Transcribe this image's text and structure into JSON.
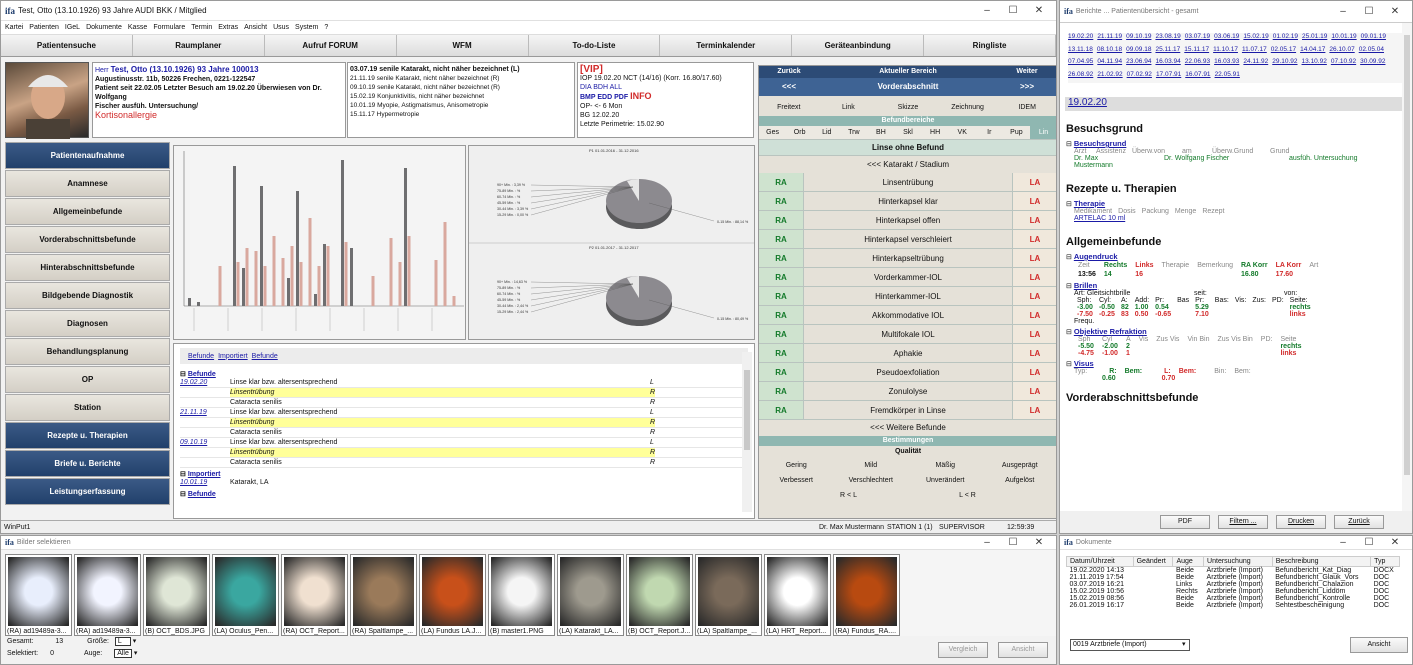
{
  "main_window": {
    "title": "Test, Otto   (13.10.1926)  93 Jahre      AUDI BKK / Mitglied",
    "logo": "ifa",
    "menu": [
      "Kartei",
      "Patienten",
      "IGeL",
      "Dokumente",
      "Kasse",
      "Formulare",
      "Termin",
      "Extras",
      "Ansicht",
      "Usus",
      "System",
      "?"
    ],
    "topnav": [
      "Patientensuche",
      "Raumplaner",
      "Aufruf FORUM",
      "WFM",
      "To-do-Liste",
      "Terminkalender",
      "Geräteanbindung",
      "Ringliste"
    ],
    "window_controls": {
      "minimize": "–",
      "maximize": "☐",
      "close": "✕"
    }
  },
  "patient": {
    "prefix": "Herr",
    "name_line": "Test, Otto     (13.10.1926)  93 Jahre    100013",
    "address": "Augustinusstr. 11b, 50226 Frechen, 0221-122547",
    "since": "Patient seit 22.02.05  Letzter Besuch am 19.02.20  Überwiesen von Dr. Wolfgang",
    "referrer": "Fischer          ausfüh. Untersuchung/",
    "allergy": "Kortisonallergie"
  },
  "diagnoses": [
    "03.07.19 senile Katarakt, nicht näher bezeichnet (L)",
    "21.11.19 senile Katarakt, nicht näher bezeichnet (R)",
    "09.10.19 senile Katarakt, nicht näher bezeichnet (R)",
    "15.02.19 Konjunktivitis, nicht näher bezeichnet",
    "10.01.19 Myopie, Astigmatismus, Anisometropie",
    "15.11.17 Hypermetropie"
  ],
  "vip": {
    "tag": "[VIP]",
    "iop": "IOP 19.02.20 NCT (14/16) (Korr. 16.80/17.60)",
    "codes1": "DIA BDH ALL",
    "codes2": "BMP EDD PDF",
    "info": "INFO",
    "op": "OP- <- 6 Mon",
    "bg": "BG  12.02.20",
    "perimetrie": "Letzte Perimetrie:  15.02.90"
  },
  "left_nav": [
    {
      "label": "Patientenaufnahme",
      "dark": true
    },
    {
      "label": "Anamnese",
      "dark": false
    },
    {
      "label": "Allgemeinbefunde",
      "dark": false
    },
    {
      "label": "Vorderabschnittsbefunde",
      "dark": false
    },
    {
      "label": "Hinterabschnittsbefunde",
      "dark": false
    },
    {
      "label": "Bildgebende Diagnostik",
      "dark": false
    },
    {
      "label": "Diagnosen",
      "dark": false
    },
    {
      "label": "Behandlungsplanung",
      "dark": false
    },
    {
      "label": "OP",
      "dark": false
    },
    {
      "label": "Station",
      "dark": false
    },
    {
      "label": "Rezepte u. Therapien",
      "dark": true
    },
    {
      "label": "Briefe u. Berichte",
      "dark": true
    },
    {
      "label": "Leistungserfassung",
      "dark": true
    }
  ],
  "pie_charts": [
    {
      "title": "P1  01.01.2016 - 31.12.2016",
      "legend": [
        "90+ Min. : 3,39 %",
        "75-89 Min. : %",
        "60-74 Min. : %",
        "45-59 Min. : %",
        "30-44 Min. : 3,39 %",
        "15-29 Min. : 0,00 %"
      ],
      "big": "0-15 Min. : 88,14 %"
    },
    {
      "title": "P2  01.01.2017 - 31.12.2017",
      "legend": [
        "90+ Min. : 14,63 %",
        "75-89 Min. : %",
        "60-74 Min. : %",
        "45-59 Min. : %",
        "30-44 Min. : 2,44 %",
        "15-29 Min. : 2,44 %"
      ],
      "big": "0-15 Min. : 80,49 %"
    }
  ],
  "befunde": {
    "tabs": [
      "Befunde",
      "Importiert",
      "Befunde"
    ],
    "section1": "Befunde",
    "entries": [
      {
        "date": "19.02.20",
        "text": "Linse klar bzw. altersentsprechend",
        "side": "L",
        "hl": false
      },
      {
        "date": "",
        "text": "Linsentrübung",
        "side": "R",
        "hl": true
      },
      {
        "date": "",
        "text": "Cataracta senilis",
        "side": "R",
        "hl": false
      },
      {
        "date": "21.11.19",
        "text": "Linse klar bzw. altersentsprechend",
        "side": "L",
        "hl": false
      },
      {
        "date": "",
        "text": "Linsentrübung",
        "side": "R",
        "hl": true
      },
      {
        "date": "",
        "text": "Cataracta senilis",
        "side": "R",
        "hl": false
      },
      {
        "date": "09.10.19",
        "text": "Linse klar bzw. altersentsprechend",
        "side": "L",
        "hl": false
      },
      {
        "date": "",
        "text": "Linsentrübung",
        "side": "R",
        "hl": true
      },
      {
        "date": "",
        "text": "Cataracta senilis",
        "side": "R",
        "hl": false
      }
    ],
    "section2": "Importiert",
    "imported": {
      "date": "10.01.19",
      "text": "Katarakt, LA"
    },
    "section3": "Befunde"
  },
  "bereich": {
    "back": "Zurück",
    "current_label": "Aktueller Bereich",
    "forward": "Weiter",
    "back_arrow": "<<<",
    "current": "Vorderabschnitt",
    "forward_arrow": ">>>",
    "tools": [
      "Freitext",
      "Link",
      "Skizze",
      "Zeichnung",
      "IDEM"
    ],
    "befundbereiche": "Befundbereiche",
    "tabs": [
      "Ges",
      "Orb",
      "Lid",
      "Trw",
      "BH",
      "Skl",
      "HH",
      "VK",
      "Ir",
      "Pup",
      "Lin"
    ],
    "header": "Linse ohne Befund",
    "stadium": "<<< Katarakt / Stadium",
    "rows": [
      "Linsentrübung",
      "Hinterkapsel klar",
      "Hinterkapsel offen",
      "Hinterkapsel verschleiert",
      "Hinterkapseltrübung",
      "Vorderkammer-IOL",
      "Hinterkammer-IOL",
      "Akkommodative IOL",
      "Multifokale IOL",
      "Aphakie",
      "Pseudoexfoliation",
      "Zonulolyse",
      "Fremdkörper in Linse"
    ],
    "ra": "RA",
    "la": "LA",
    "more": "<<< Weitere Befunde",
    "bestimmungen": "Bestimmungen",
    "qualitat": "Qualität",
    "q1": [
      "Gering",
      "Mild",
      "Mäßig",
      "Ausgeprägt"
    ],
    "q2": [
      "Verbessert",
      "Verschlechtert",
      "Unverändert",
      "Aufgelöst"
    ],
    "q3": [
      "R < L",
      "L < R"
    ]
  },
  "status_bar": {
    "left": "WinPut1",
    "doctor": "Dr. Max Mustermann",
    "station": "STATION 1 (1)",
    "role": "SUPERVISOR",
    "time": "12:59:39"
  },
  "images_window": {
    "title": "Bilder selektieren",
    "thumbs": [
      "(RA) ad19489a-3...",
      "(RA) ad19489a-3...",
      "(B) OCT_BDS.JPG",
      "(LA) Oculus_Pen...",
      "(RA) OCT_Report...",
      "(RA) Spaltlampe_...",
      "(LA) Fundus LA.J...",
      "(B) master1.PNG",
      "(LA) Katarakt_LA...",
      "(B) OCT_Report.J...",
      "(LA) Spaltlampe_...",
      "(LA) HRT_Report...",
      "(RA) Fundus_RA...."
    ],
    "gesamt_label": "Gesamt:",
    "gesamt": "13",
    "groesse_label": "Größe:",
    "groesse": "L",
    "selektiert_label": "Selektiert:",
    "selektiert": "0",
    "auge_label": "Auge:",
    "auge": "Alle",
    "vergleich": "Vergleich",
    "ansicht": "Ansicht"
  },
  "report_window": {
    "title": "Berichte ... Patientenübersicht - gesamt",
    "dates": [
      "19.02.20",
      "21.11.19",
      "09.10.19",
      "23.08.19",
      "03.07.19",
      "03.06.19",
      "15.02.19",
      "01.02.19",
      "25.01.19",
      "10.01.19",
      "09.01.19",
      "13.11.18",
      "08.10.18",
      "09.09.18",
      "25.11.17",
      "15.11.17",
      "11.10.17",
      "11.07.17",
      "02.05.17",
      "14.04.17",
      "26.10.07",
      "02.05.04",
      "07.04.95",
      "04.11.94",
      "23.06.94",
      "16.03.94",
      "22.06.93",
      "16.03.93",
      "24.11.92",
      "29.10.92",
      "13.10.92",
      "07.10.92",
      "30.09.92",
      "26.08.92",
      "21.02.92",
      "07.02.92",
      "17.07.91",
      "16.07.91",
      "22.05.91"
    ],
    "current_date": "19.02.20",
    "besuchsgrund": "Besuchsgrund",
    "bg_sub": "Besuchsgrund",
    "bg_headers": [
      "Arzt",
      "Assistenz",
      "Überw.von",
      "am",
      "Überw.Grund",
      "Grund"
    ],
    "bg_arzt": "Dr. Max Mustermann",
    "bg_ueberw": "Dr. Wolfgang Fischer",
    "bg_grund": "ausfüh. Untersuchung",
    "rezepte": "Rezepte u. Therapien",
    "therapie": "Therapie",
    "th_headers": [
      "Medikament",
      "Dosis",
      "Packung",
      "Menge",
      "Rezept"
    ],
    "th_med": "ARTELAC 10 ml",
    "allgemein": "Allgemeinbefunde",
    "augendruck": "Augendruck",
    "ad_headers": [
      "Zeit",
      "Rechts",
      "Links",
      "Therapie",
      "Bemerkung",
      "RA Korr",
      "LA Korr",
      "Art"
    ],
    "ad_values": [
      "13:56",
      "14",
      "16",
      "",
      "",
      "16.80",
      "17.60",
      ""
    ],
    "brillen": "Brillen",
    "brillen_art": "Art:    Gleitsichtbrille",
    "brillen_seit": "seit:",
    "brillen_von": "von:",
    "br_headers": [
      "Sph:",
      "Cyl:",
      "A:",
      "Add:",
      "Pr:",
      "Bas",
      "Pr:",
      "Bas:",
      "Vis:",
      "Zus:",
      "PD:",
      "Seite:"
    ],
    "br_r": [
      "-3.00",
      "-0.50",
      "82",
      "1.00",
      "0.54",
      "",
      "5.29",
      "",
      "",
      "",
      "",
      "rechts"
    ],
    "br_l": [
      "-7.50",
      "-0.25",
      "83",
      "0.50",
      "-0.65",
      "",
      "7.10",
      "",
      "",
      "",
      "",
      "links"
    ],
    "frequ": "Frequ.",
    "obj_ref": "Objektive Refraktion",
    "or_headers": [
      "Sph",
      "Cyl",
      "A",
      "Vis",
      "Zus Vis",
      "Vin Bin",
      "Zus Vis Bin",
      "PD:",
      "Seite"
    ],
    "or_r": [
      "-5.50",
      "-2.00",
      "2",
      "",
      "",
      "",
      "",
      "",
      "rechts"
    ],
    "or_l": [
      "-4.75",
      "-1.00",
      "1",
      "",
      "",
      "",
      "",
      "",
      "links"
    ],
    "visus": "Visus",
    "visus_typ": "Typ:",
    "visus_r": "R:",
    "visus_rbem": "Bem:",
    "visus_l": "L:",
    "visus_lbem": "Bem:",
    "visus_bin": "Bin:",
    "visus_binbem": "Bem:",
    "visus_rv": "0.60",
    "visus_lv": "0.70",
    "vorder": "Vorderabschnittsbefunde",
    "buttons": [
      "PDF",
      "Filtern ...",
      "Drucken",
      "Zurück"
    ]
  },
  "docs_window": {
    "title": "Dokumente",
    "headers": [
      "Datum/Uhrzeit",
      "Geändert",
      "Auge",
      "Untersuchung",
      "Beschreibung",
      "Typ"
    ],
    "rows": [
      [
        "19.02.2020  14:13",
        "",
        "Beide",
        "Arztbriefe (Import)",
        "Befundbericht_Kat_Diag",
        "DOCX"
      ],
      [
        "21.11.2019  17:54",
        "",
        "Beide",
        "Arztbriefe (Import)",
        "Befundbericht_Glauk_Vors",
        "DOC"
      ],
      [
        "03.07.2019  16:21",
        "",
        "Links",
        "Arztbriefe (Import)",
        "Befundbericht_Chalazion",
        "DOC"
      ],
      [
        "15.02.2019  10:56",
        "",
        "Rechts",
        "Arztbriefe (Import)",
        "Befundbericht_Liddöm",
        "DOC"
      ],
      [
        "15.02.2019  08:56",
        "",
        "Beide",
        "Arztbriefe (Import)",
        "Befundbericht_Kontrolle",
        "DOC"
      ],
      [
        "26.01.2019  16:17",
        "",
        "Beide",
        "Arztbriefe (Import)",
        "Sehtestbescheinigung",
        "DOC"
      ]
    ],
    "filter": "0019  Arztbriefe (Import)",
    "ansicht": "Ansicht"
  }
}
